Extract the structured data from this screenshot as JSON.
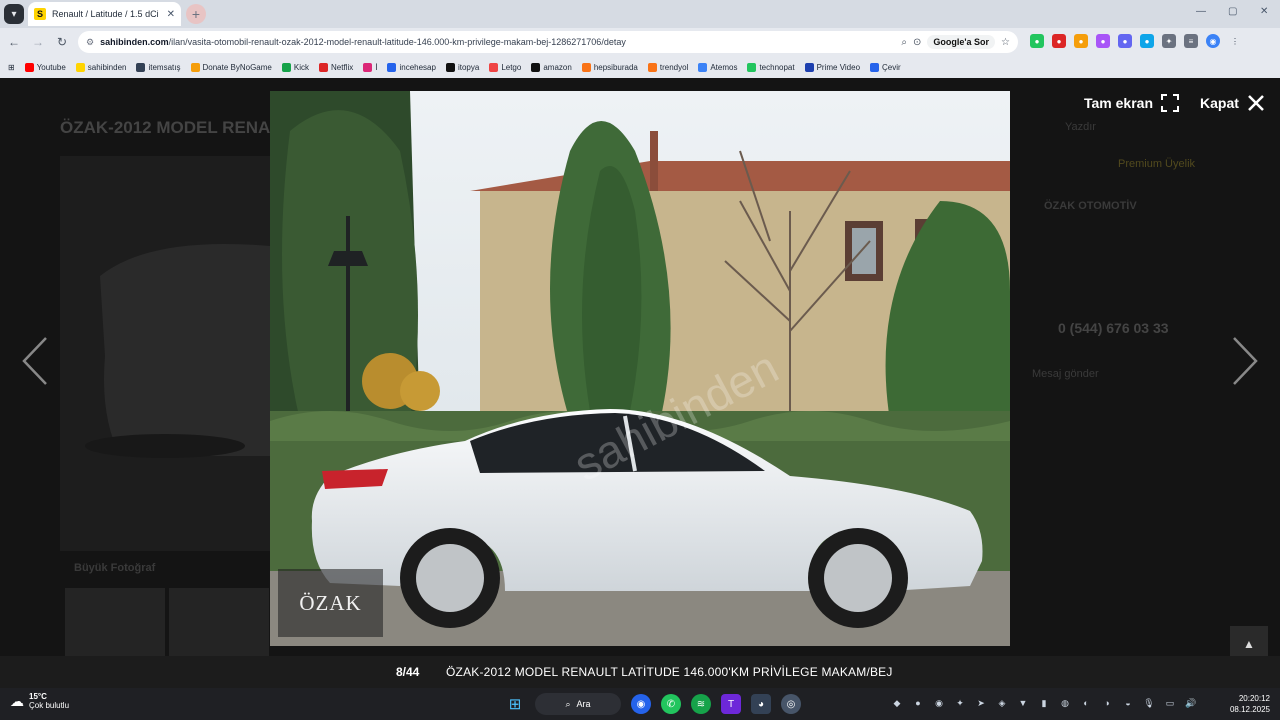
{
  "browser": {
    "tab_title": "Renault / Latitude / 1.5 dCi / P...",
    "tab_favicon": "S",
    "url_domain": "sahibinden.com",
    "url_path": "/ilan/vasita-otomobil-renault-ozak-2012-model-renault-latitude-146.000-km-privilege-makam-bej-1286271706/detay",
    "google_ask": "Google'a Sor",
    "bookmarks": [
      "Youtube",
      "sahibinden",
      "itemsatış",
      "Donate ByNoGame",
      "Kick",
      "Netflix",
      "İ",
      "incehesap",
      "itopya",
      "Letgo",
      "amazon",
      "hepsiburada",
      "trendyol",
      "Atemos",
      "technopat",
      "Prime Video",
      "Çevir"
    ]
  },
  "background_page": {
    "listing_title": "ÖZAK-2012 MODEL RENA",
    "seller_name": "ÖZAK OTOMOTİV",
    "phone": "0 (544) 676 03 33",
    "big_photo_label": "Büyük Fotoğraf",
    "message_label": "Mesaj gönder",
    "print_label": "Yazdır",
    "premium_label": "Premium Üyelik"
  },
  "lightbox": {
    "fullscreen_label": "Tam ekran",
    "close_label": "Kapat",
    "watermark": "ÖZAK",
    "photo_counter": "8/44",
    "caption": "ÖZAK-2012 MODEL RENAULT LATİTUDE 146.000'KM PRİVİLEGE MAKAM/BEJ"
  },
  "taskbar": {
    "temperature": "15°C",
    "weather": "Çok bulutlu",
    "search_label": "Ara",
    "time": "20:20:12",
    "date": "08.12.2025"
  }
}
